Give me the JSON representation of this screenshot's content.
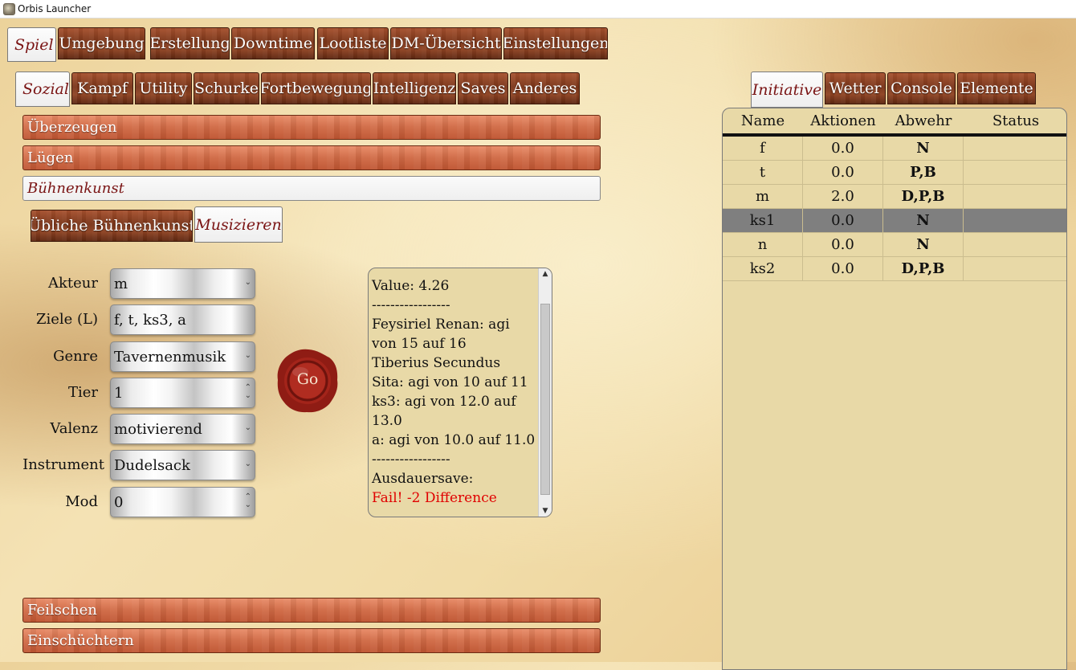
{
  "window": {
    "title": "Orbis Launcher",
    "icon": "app-icon"
  },
  "main_tabs": [
    {
      "label": "Spiel",
      "active": true
    },
    {
      "label": "Umgebung"
    },
    {
      "label": "Erstellung"
    },
    {
      "label": "Downtime"
    },
    {
      "label": "Lootliste"
    },
    {
      "label": "DM-Übersicht"
    },
    {
      "label": "Einstellungen"
    }
  ],
  "sub_tabs": [
    {
      "label": "Sozial",
      "active": true
    },
    {
      "label": "Kampf"
    },
    {
      "label": "Utility"
    },
    {
      "label": "Schurke"
    },
    {
      "label": "Fortbewegung"
    },
    {
      "label": "Intelligenz"
    },
    {
      "label": "Saves"
    },
    {
      "label": "Anderes"
    }
  ],
  "skills": {
    "ueberzeugen": "Überzeugen",
    "luegen": "Lügen",
    "buehnenkunst": "Bühnenkunst",
    "feilschen": "Feilschen",
    "einschuechtern": "Einschüchtern"
  },
  "skill_tabs": [
    {
      "label": "Übliche Bühnenkunst"
    },
    {
      "label": "Musizieren",
      "active": true
    }
  ],
  "form": {
    "actor": {
      "label": "Akteur",
      "value": "m"
    },
    "targets": {
      "label": "Ziele (L)",
      "value": "f, t, ks3, a"
    },
    "genre": {
      "label": "Genre",
      "value": "Tavernenmusik"
    },
    "tier": {
      "label": "Tier",
      "value": "1"
    },
    "valence": {
      "label": "Valenz",
      "value": "motivierend"
    },
    "instrument": {
      "label": "Instrument",
      "value": "Dudelsack"
    },
    "mod": {
      "label": "Mod",
      "value": "0"
    }
  },
  "go_button": "Go",
  "output_lines": [
    {
      "text": "-----------------"
    },
    {
      "text": "Value: 4.26"
    },
    {
      "text": "-----------------"
    },
    {
      "text": "Feysiriel Renan: agi von 15 auf 16"
    },
    {
      "text": "Tiberius Secundus Sita: agi von 10 auf 11"
    },
    {
      "text": "ks3: agi von 12.0 auf 13.0"
    },
    {
      "text": "a: agi von 10.0 auf 11.0"
    },
    {
      "text": "-----------------"
    },
    {
      "text": "Ausdauersave:"
    },
    {
      "text": "Fail! -2 Difference",
      "fail": true
    }
  ],
  "right_tabs": [
    {
      "label": "Initiative",
      "active": true
    },
    {
      "label": "Wetter"
    },
    {
      "label": "Console"
    },
    {
      "label": "Elemente"
    }
  ],
  "initiative": {
    "columns": [
      "Name",
      "Aktionen",
      "Abwehr",
      "Status"
    ],
    "rows": [
      {
        "name": "f",
        "actions": "0.0",
        "defense": "N",
        "status": ""
      },
      {
        "name": "t",
        "actions": "0.0",
        "defense": "P,B",
        "status": ""
      },
      {
        "name": "m",
        "actions": "2.0",
        "defense": "D,P,B",
        "status": ""
      },
      {
        "name": "ks1",
        "actions": "0.0",
        "defense": "N",
        "status": "",
        "selected": true
      },
      {
        "name": "n",
        "actions": "0.0",
        "defense": "N",
        "status": ""
      },
      {
        "name": "ks2",
        "actions": "0.0",
        "defense": "D,P,B",
        "status": ""
      }
    ]
  },
  "colors": {
    "accent_text": "#7a1414",
    "fail": "#e00000",
    "panel": "#e8d9a7",
    "selected_row": "#7f7f7f"
  }
}
